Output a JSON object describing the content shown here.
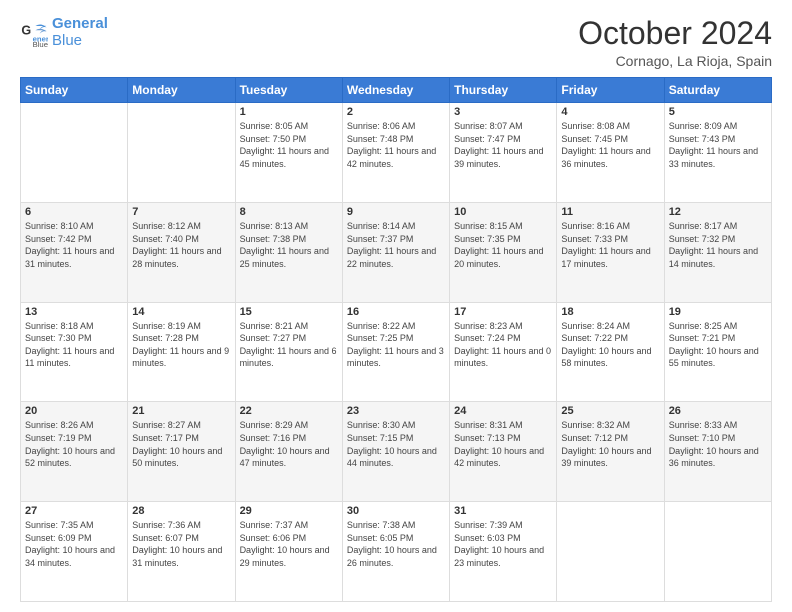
{
  "logo": {
    "line1": "General",
    "line2": "Blue"
  },
  "title": "October 2024",
  "location": "Cornago, La Rioja, Spain",
  "weekdays": [
    "Sunday",
    "Monday",
    "Tuesday",
    "Wednesday",
    "Thursday",
    "Friday",
    "Saturday"
  ],
  "weeks": [
    [
      {
        "day": "",
        "info": ""
      },
      {
        "day": "",
        "info": ""
      },
      {
        "day": "1",
        "info": "Sunrise: 8:05 AM\nSunset: 7:50 PM\nDaylight: 11 hours and 45 minutes."
      },
      {
        "day": "2",
        "info": "Sunrise: 8:06 AM\nSunset: 7:48 PM\nDaylight: 11 hours and 42 minutes."
      },
      {
        "day": "3",
        "info": "Sunrise: 8:07 AM\nSunset: 7:47 PM\nDaylight: 11 hours and 39 minutes."
      },
      {
        "day": "4",
        "info": "Sunrise: 8:08 AM\nSunset: 7:45 PM\nDaylight: 11 hours and 36 minutes."
      },
      {
        "day": "5",
        "info": "Sunrise: 8:09 AM\nSunset: 7:43 PM\nDaylight: 11 hours and 33 minutes."
      }
    ],
    [
      {
        "day": "6",
        "info": "Sunrise: 8:10 AM\nSunset: 7:42 PM\nDaylight: 11 hours and 31 minutes."
      },
      {
        "day": "7",
        "info": "Sunrise: 8:12 AM\nSunset: 7:40 PM\nDaylight: 11 hours and 28 minutes."
      },
      {
        "day": "8",
        "info": "Sunrise: 8:13 AM\nSunset: 7:38 PM\nDaylight: 11 hours and 25 minutes."
      },
      {
        "day": "9",
        "info": "Sunrise: 8:14 AM\nSunset: 7:37 PM\nDaylight: 11 hours and 22 minutes."
      },
      {
        "day": "10",
        "info": "Sunrise: 8:15 AM\nSunset: 7:35 PM\nDaylight: 11 hours and 20 minutes."
      },
      {
        "day": "11",
        "info": "Sunrise: 8:16 AM\nSunset: 7:33 PM\nDaylight: 11 hours and 17 minutes."
      },
      {
        "day": "12",
        "info": "Sunrise: 8:17 AM\nSunset: 7:32 PM\nDaylight: 11 hours and 14 minutes."
      }
    ],
    [
      {
        "day": "13",
        "info": "Sunrise: 8:18 AM\nSunset: 7:30 PM\nDaylight: 11 hours and 11 minutes."
      },
      {
        "day": "14",
        "info": "Sunrise: 8:19 AM\nSunset: 7:28 PM\nDaylight: 11 hours and 9 minutes."
      },
      {
        "day": "15",
        "info": "Sunrise: 8:21 AM\nSunset: 7:27 PM\nDaylight: 11 hours and 6 minutes."
      },
      {
        "day": "16",
        "info": "Sunrise: 8:22 AM\nSunset: 7:25 PM\nDaylight: 11 hours and 3 minutes."
      },
      {
        "day": "17",
        "info": "Sunrise: 8:23 AM\nSunset: 7:24 PM\nDaylight: 11 hours and 0 minutes."
      },
      {
        "day": "18",
        "info": "Sunrise: 8:24 AM\nSunset: 7:22 PM\nDaylight: 10 hours and 58 minutes."
      },
      {
        "day": "19",
        "info": "Sunrise: 8:25 AM\nSunset: 7:21 PM\nDaylight: 10 hours and 55 minutes."
      }
    ],
    [
      {
        "day": "20",
        "info": "Sunrise: 8:26 AM\nSunset: 7:19 PM\nDaylight: 10 hours and 52 minutes."
      },
      {
        "day": "21",
        "info": "Sunrise: 8:27 AM\nSunset: 7:17 PM\nDaylight: 10 hours and 50 minutes."
      },
      {
        "day": "22",
        "info": "Sunrise: 8:29 AM\nSunset: 7:16 PM\nDaylight: 10 hours and 47 minutes."
      },
      {
        "day": "23",
        "info": "Sunrise: 8:30 AM\nSunset: 7:15 PM\nDaylight: 10 hours and 44 minutes."
      },
      {
        "day": "24",
        "info": "Sunrise: 8:31 AM\nSunset: 7:13 PM\nDaylight: 10 hours and 42 minutes."
      },
      {
        "day": "25",
        "info": "Sunrise: 8:32 AM\nSunset: 7:12 PM\nDaylight: 10 hours and 39 minutes."
      },
      {
        "day": "26",
        "info": "Sunrise: 8:33 AM\nSunset: 7:10 PM\nDaylight: 10 hours and 36 minutes."
      }
    ],
    [
      {
        "day": "27",
        "info": "Sunrise: 7:35 AM\nSunset: 6:09 PM\nDaylight: 10 hours and 34 minutes."
      },
      {
        "day": "28",
        "info": "Sunrise: 7:36 AM\nSunset: 6:07 PM\nDaylight: 10 hours and 31 minutes."
      },
      {
        "day": "29",
        "info": "Sunrise: 7:37 AM\nSunset: 6:06 PM\nDaylight: 10 hours and 29 minutes."
      },
      {
        "day": "30",
        "info": "Sunrise: 7:38 AM\nSunset: 6:05 PM\nDaylight: 10 hours and 26 minutes."
      },
      {
        "day": "31",
        "info": "Sunrise: 7:39 AM\nSunset: 6:03 PM\nDaylight: 10 hours and 23 minutes."
      },
      {
        "day": "",
        "info": ""
      },
      {
        "day": "",
        "info": ""
      }
    ]
  ]
}
